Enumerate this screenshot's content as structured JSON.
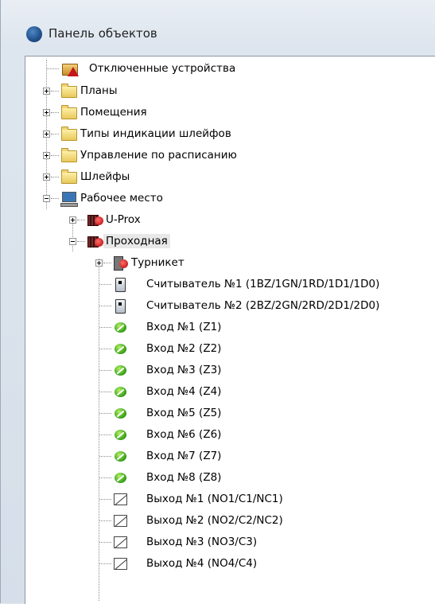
{
  "window": {
    "title": "Панель объектов"
  },
  "tree": {
    "items": [
      {
        "label": "Отключенные устройства"
      },
      {
        "label": "Планы"
      },
      {
        "label": "Помещения"
      },
      {
        "label": "Типы индикации шлейфов"
      },
      {
        "label": "Управление по расписанию"
      },
      {
        "label": "Шлейфы"
      },
      {
        "label": "Рабочее место"
      },
      {
        "label": "U-Prox"
      },
      {
        "label": "Проходная"
      },
      {
        "label": "Турникет"
      },
      {
        "label": "Считыватель №1 (1BZ/1GN/1RD/1D1/1D0)"
      },
      {
        "label": "Считыватель №2 (2BZ/2GN/2RD/2D1/2D0)"
      },
      {
        "label": "Вход №1 (Z1)"
      },
      {
        "label": "Вход №2 (Z2)"
      },
      {
        "label": "Вход №3 (Z3)"
      },
      {
        "label": "Вход №4 (Z4)"
      },
      {
        "label": "Вход №5 (Z5)"
      },
      {
        "label": "Вход №6 (Z6)"
      },
      {
        "label": "Вход №7 (Z7)"
      },
      {
        "label": "Вход №8 (Z8)"
      },
      {
        "label": "Выход №1 (NO1/C1/NC1)"
      },
      {
        "label": "Выход №2 (NO2/C2/NC2)"
      },
      {
        "label": "Выход №3 (NO3/C3)"
      },
      {
        "label": "Выход №4 (NO4/C4)"
      }
    ]
  }
}
